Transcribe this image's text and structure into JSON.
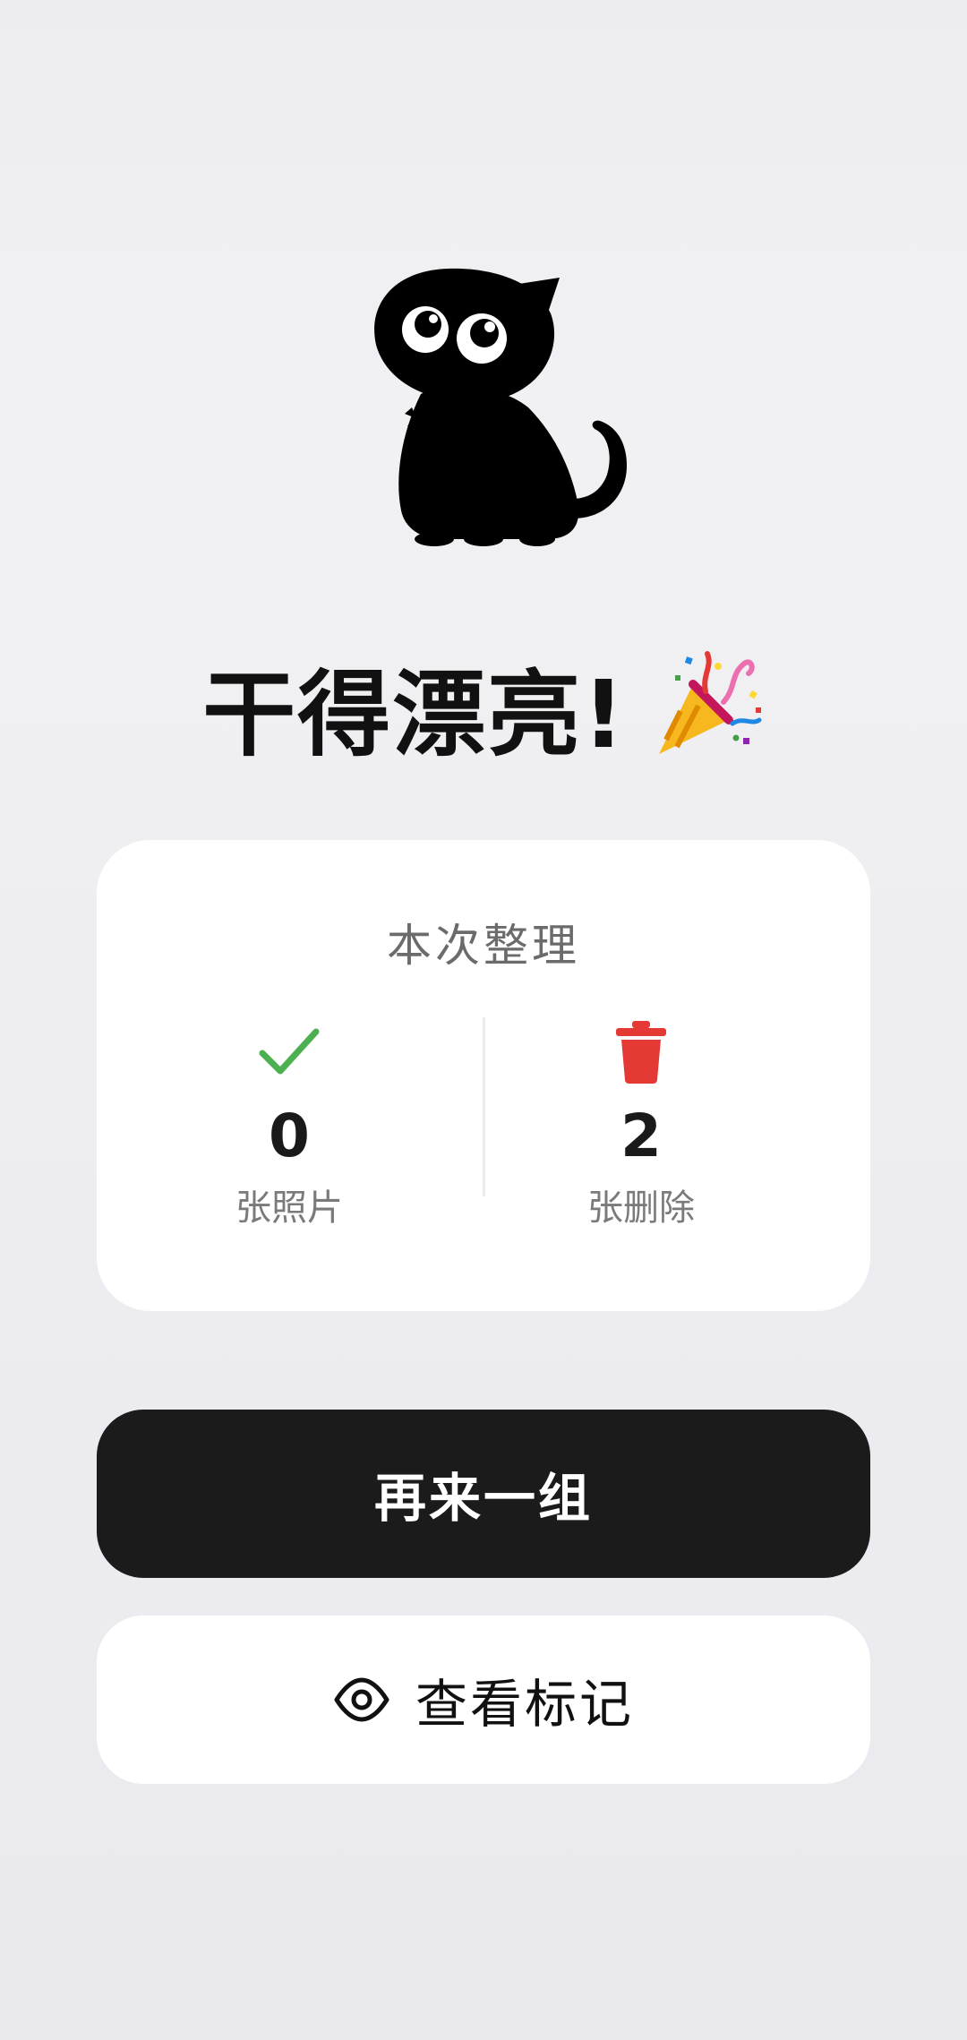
{
  "headline": {
    "text": "干得漂亮!",
    "emoji": "party-popper-icon"
  },
  "mascot": {
    "icon": "black-cat-illustration"
  },
  "summary": {
    "title": "本次整理",
    "stats": [
      {
        "icon": "checkmark-icon",
        "icon_color": "#4caf50",
        "value": "0",
        "label": "张照片"
      },
      {
        "icon": "trash-icon",
        "icon_color": "#e53935",
        "value": "2",
        "label": "张删除"
      }
    ]
  },
  "actions": {
    "primary_label": "再来一组",
    "secondary_label": "查看标记",
    "secondary_icon": "eye-icon"
  },
  "colors": {
    "background": "#ededf0",
    "card": "#ffffff",
    "primary_button": "#1b1b1b",
    "text": "#111111"
  }
}
